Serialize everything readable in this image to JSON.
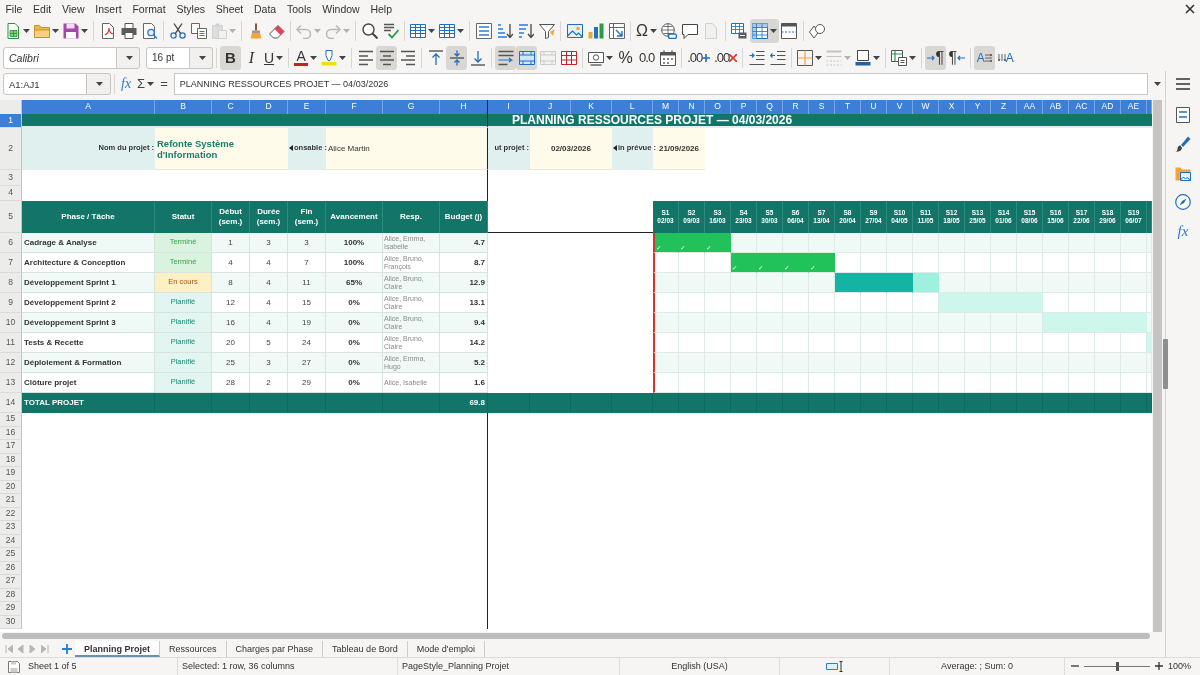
{
  "menu_bar": [
    "File",
    "Edit",
    "View",
    "Insert",
    "Format",
    "Styles",
    "Sheet",
    "Data",
    "Tools",
    "Window",
    "Help"
  ],
  "standard_toolbar": [
    [
      {
        "kind": "new",
        "dropdown": true,
        "pressed": false,
        "disabled": false
      },
      {
        "kind": "open",
        "dropdown": true,
        "pressed": false,
        "disabled": false
      },
      {
        "kind": "save",
        "dropdown": true,
        "pressed": false,
        "disabled": false
      }
    ],
    [
      {
        "kind": "export_pdf",
        "dropdown": false,
        "pressed": false,
        "disabled": false
      },
      {
        "kind": "print",
        "dropdown": false,
        "pressed": false,
        "disabled": false
      },
      {
        "kind": "print_preview",
        "dropdown": false,
        "pressed": false,
        "disabled": false
      }
    ],
    [
      {
        "kind": "cut",
        "dropdown": false,
        "pressed": false,
        "disabled": false
      },
      {
        "kind": "copy",
        "dropdown": false,
        "pressed": false,
        "disabled": false
      },
      {
        "kind": "paste",
        "dropdown": true,
        "pressed": false,
        "disabled": true
      }
    ],
    [
      {
        "kind": "clone_formatting",
        "dropdown": false,
        "pressed": false,
        "disabled": false
      },
      {
        "kind": "clear_formatting",
        "dropdown": false,
        "pressed": false,
        "disabled": false
      }
    ],
    [
      {
        "kind": "undo",
        "dropdown": true,
        "pressed": false,
        "disabled": true
      },
      {
        "kind": "redo",
        "dropdown": true,
        "pressed": false,
        "disabled": true
      }
    ],
    [
      {
        "kind": "find_replace",
        "dropdown": false,
        "pressed": false,
        "disabled": false
      },
      {
        "kind": "spelling",
        "dropdown": false,
        "pressed": false,
        "disabled": false
      }
    ],
    [
      {
        "kind": "row",
        "dropdown": true,
        "pressed": false,
        "disabled": false
      },
      {
        "kind": "column",
        "dropdown": true,
        "pressed": false,
        "disabled": false
      }
    ],
    [
      {
        "kind": "sort",
        "dropdown": false,
        "pressed": false,
        "disabled": false
      },
      {
        "kind": "sort_ascending",
        "dropdown": false,
        "pressed": false,
        "disabled": false
      },
      {
        "kind": "sort_descending",
        "dropdown": false,
        "pressed": false,
        "disabled": false
      },
      {
        "kind": "autofilter",
        "dropdown": false,
        "pressed": false,
        "disabled": false
      }
    ],
    [
      {
        "kind": "image",
        "dropdown": false,
        "pressed": false,
        "disabled": false
      },
      {
        "kind": "chart",
        "dropdown": false,
        "pressed": false,
        "disabled": false
      },
      {
        "kind": "pivot_table",
        "dropdown": false,
        "pressed": false,
        "disabled": false
      }
    ],
    [
      {
        "kind": "special_character",
        "glyph": "Ω",
        "dropdown": true,
        "pressed": false,
        "disabled": false
      },
      {
        "kind": "hyperlink",
        "dropdown": false,
        "pressed": false,
        "disabled": false
      },
      {
        "kind": "comment",
        "dropdown": false,
        "pressed": false,
        "disabled": false
      },
      {
        "kind": "header_footer",
        "dropdown": false,
        "pressed": false,
        "disabled": true
      }
    ],
    [
      {
        "kind": "print_area",
        "dropdown": false,
        "pressed": false,
        "disabled": false
      },
      {
        "kind": "freeze",
        "dropdown": true,
        "pressed": true,
        "disabled": false
      },
      {
        "kind": "split_window",
        "dropdown": false,
        "pressed": false,
        "disabled": false
      }
    ],
    [
      {
        "kind": "draw_functions",
        "dropdown": false,
        "pressed": false,
        "disabled": false
      }
    ]
  ],
  "formatting_toolbar": {
    "font_name": "Calibri",
    "font_size": "16 pt",
    "groups": [
      [
        {
          "kind": "bold",
          "glyph": "B",
          "dropdown": false,
          "pressed": true,
          "disabled": false
        },
        {
          "kind": "italic",
          "glyph": "I",
          "dropdown": false,
          "pressed": false,
          "disabled": false
        },
        {
          "kind": "underline",
          "glyph": "U",
          "dropdown": true,
          "pressed": false,
          "disabled": false
        }
      ],
      [
        {
          "kind": "font_color",
          "glyph": "A",
          "dropdown": true,
          "pressed": false,
          "disabled": false
        },
        {
          "kind": "highlight",
          "dropdown": true,
          "pressed": false,
          "disabled": false
        }
      ],
      [
        {
          "kind": "align_left",
          "dropdown": false,
          "pressed": false,
          "disabled": false
        },
        {
          "kind": "align_center",
          "dropdown": false,
          "pressed": true,
          "disabled": false
        },
        {
          "kind": "align_right",
          "dropdown": false,
          "pressed": false,
          "disabled": false
        }
      ],
      [
        {
          "kind": "align_top",
          "dropdown": false,
          "pressed": false,
          "disabled": false
        },
        {
          "kind": "align_middle",
          "dropdown": false,
          "pressed": true,
          "disabled": false
        },
        {
          "kind": "align_bottom",
          "dropdown": false,
          "pressed": false,
          "disabled": false
        }
      ],
      [
        {
          "kind": "wrap_text",
          "dropdown": false,
          "pressed": true,
          "disabled": false
        },
        {
          "kind": "merge_center",
          "dropdown": false,
          "pressed": true,
          "disabled": false
        },
        {
          "kind": "merge_cells",
          "dropdown": false,
          "pressed": false,
          "disabled": true
        },
        {
          "kind": "unmerge_cells",
          "dropdown": false,
          "pressed": false,
          "disabled": false
        }
      ],
      [
        {
          "kind": "number_format",
          "dropdown": true,
          "pressed": false,
          "disabled": false
        },
        {
          "kind": "percent",
          "glyph": "%",
          "dropdown": false,
          "pressed": false,
          "disabled": false
        },
        {
          "kind": "standard",
          "glyph": "0.0",
          "dropdown": false,
          "pressed": false,
          "disabled": false
        },
        {
          "kind": "date",
          "dropdown": false,
          "pressed": false,
          "disabled": false
        }
      ],
      [
        {
          "kind": "add_decimal",
          "glyph": ".00",
          "dropdown": false,
          "pressed": false,
          "disabled": false
        },
        {
          "kind": "delete_decimal",
          "glyph": ".00",
          "dropdown": false,
          "pressed": false,
          "disabled": false
        }
      ],
      [
        {
          "kind": "indent",
          "dropdown": false,
          "pressed": false,
          "disabled": false
        },
        {
          "kind": "outdent",
          "dropdown": false,
          "pressed": false,
          "disabled": false
        }
      ],
      [
        {
          "kind": "borders",
          "dropdown": true,
          "pressed": false,
          "disabled": false
        },
        {
          "kind": "border_style",
          "dropdown": true,
          "pressed": false,
          "disabled": true
        },
        {
          "kind": "border_color",
          "dropdown": true,
          "pressed": false,
          "disabled": false
        }
      ],
      [
        {
          "kind": "conditional",
          "dropdown": true,
          "pressed": false,
          "disabled": false
        }
      ],
      [
        {
          "kind": "left_to_right",
          "glyph": "¶",
          "dropdown": false,
          "pressed": true,
          "disabled": false
        },
        {
          "kind": "right_to_left",
          "glyph": "¶",
          "dropdown": false,
          "pressed": false,
          "disabled": false
        }
      ],
      [
        {
          "kind": "text_horizontal",
          "glyph": "A",
          "dropdown": false,
          "pressed": true,
          "disabled": false
        },
        {
          "kind": "text_vertical",
          "glyph": "A",
          "dropdown": false,
          "pressed": false,
          "disabled": false
        }
      ]
    ]
  },
  "formula_bar": {
    "name_box": "A1:AJ1",
    "wizard_glyph": "fx",
    "sum_glyph": "Σ",
    "equals_glyph": "=",
    "content": "PLANNING RESSOURCES PROJET — 04/03/2026"
  },
  "sidebar": {
    "tabs": [
      {
        "kind": "properties",
        "selected": false
      },
      {
        "kind": "styles",
        "selected": false
      },
      {
        "kind": "gallery",
        "selected": false
      },
      {
        "kind": "navigator",
        "selected": false
      },
      {
        "kind": "functions",
        "glyph": "fx",
        "selected": false
      }
    ]
  },
  "grid": {
    "columns": [
      {
        "label": "A",
        "selected": true
      },
      {
        "label": "B",
        "selected": true
      },
      {
        "label": "C",
        "selected": true
      },
      {
        "label": "D",
        "selected": true
      },
      {
        "label": "E",
        "selected": true
      },
      {
        "label": "F",
        "selected": true
      },
      {
        "label": "G",
        "selected": true
      },
      {
        "label": "H",
        "selected": true
      },
      {
        "label": "I",
        "selected": true
      },
      {
        "label": "J",
        "selected": true
      },
      {
        "label": "K",
        "selected": true
      },
      {
        "label": "L",
        "selected": true
      },
      {
        "label": "M",
        "selected": true
      },
      {
        "label": "N",
        "selected": true
      },
      {
        "label": "O",
        "selected": true
      },
      {
        "label": "P",
        "selected": true
      },
      {
        "label": "Q",
        "selected": true
      },
      {
        "label": "R",
        "selected": true
      },
      {
        "label": "S",
        "selected": true
      },
      {
        "label": "T",
        "selected": true
      },
      {
        "label": "U",
        "selected": true
      },
      {
        "label": "V",
        "selected": true
      },
      {
        "label": "W",
        "selected": true
      },
      {
        "label": "X",
        "selected": true
      },
      {
        "label": "Y",
        "selected": true
      },
      {
        "label": "Z",
        "selected": true
      },
      {
        "label": "AA",
        "selected": true
      },
      {
        "label": "AB",
        "selected": true
      },
      {
        "label": "AC",
        "selected": true
      },
      {
        "label": "AD",
        "selected": true
      },
      {
        "label": "AE",
        "selected": true
      },
      {
        "selected": true
      }
    ],
    "rows": [
      {
        "label": "1",
        "selected": true
      },
      {
        "label": "2",
        "selected": false
      },
      {
        "label": "3",
        "selected": false
      },
      {
        "label": "4",
        "selected": false
      },
      {
        "label": "5",
        "selected": false
      },
      {
        "label": "6",
        "selected": false
      },
      {
        "label": "7",
        "selected": false
      },
      {
        "label": "8",
        "selected": false
      },
      {
        "label": "9",
        "selected": false
      },
      {
        "label": "10",
        "selected": false
      },
      {
        "label": "11",
        "selected": false
      },
      {
        "label": "12",
        "selected": false
      },
      {
        "label": "13",
        "selected": false
      },
      {
        "label": "14",
        "selected": false
      },
      {
        "label": "15",
        "selected": false
      },
      {
        "label": "16",
        "selected": false
      },
      {
        "label": "17",
        "selected": false
      },
      {
        "label": "18",
        "selected": false
      },
      {
        "label": "19",
        "selected": false
      },
      {
        "label": "20",
        "selected": false
      },
      {
        "label": "21",
        "selected": false
      },
      {
        "label": "22",
        "selected": false
      },
      {
        "label": "23",
        "selected": false
      },
      {
        "label": "24",
        "selected": false
      },
      {
        "label": "25",
        "selected": false
      },
      {
        "label": "26",
        "selected": false
      },
      {
        "label": "27",
        "selected": false
      },
      {
        "label": "28",
        "selected": false
      },
      {
        "label": "29",
        "selected": false
      },
      {
        "label": "30",
        "selected": false
      }
    ]
  },
  "sheet": {
    "title": "PLANNING RESSOURCES PROJET — 04/03/2026",
    "info": {
      "project_label": {
        "text": "Nom du projet :",
        "clipped": false
      },
      "project_name": "Refonte Système d'Information",
      "manager_label": {
        "text": "onsable :",
        "clipped": true
      },
      "manager": "Alice Martin",
      "start_label": {
        "text": "ut projet :",
        "clipped": false
      },
      "start_date": "02/03/2026",
      "end_label": {
        "text": "in prévue :",
        "clipped": true
      },
      "end_date": "21/09/2026"
    },
    "headers": [
      "Phase / Tâche",
      "Statut",
      "Début (sem.)",
      "Durée (sem.)",
      "Fin (sem.)",
      "Avancement",
      "Resp.",
      "Budget (j)"
    ],
    "weeks": [
      {
        "label": "S1",
        "date": "02/03",
        "current": true
      },
      {
        "label": "S2",
        "date": "09/03",
        "current": false
      },
      {
        "label": "S3",
        "date": "16/03",
        "current": false
      },
      {
        "label": "S4",
        "date": "23/03",
        "current": false
      },
      {
        "label": "S5",
        "date": "30/03",
        "current": false
      },
      {
        "label": "S6",
        "date": "06/04",
        "current": false
      },
      {
        "label": "S7",
        "date": "13/04",
        "current": false
      },
      {
        "label": "S8",
        "date": "20/04",
        "current": false
      },
      {
        "label": "S9",
        "date": "27/04",
        "current": false
      },
      {
        "label": "S10",
        "date": "04/05",
        "current": false
      },
      {
        "label": "S11",
        "date": "11/05",
        "current": false
      },
      {
        "label": "S12",
        "date": "18/05",
        "current": false
      },
      {
        "label": "S13",
        "date": "25/05",
        "current": false
      },
      {
        "label": "S14",
        "date": "01/06",
        "current": false
      },
      {
        "label": "S15",
        "date": "08/06",
        "current": false
      },
      {
        "label": "S16",
        "date": "15/06",
        "current": false
      },
      {
        "label": "S17",
        "date": "22/06",
        "current": false
      },
      {
        "label": "S18",
        "date": "29/06",
        "current": false
      },
      {
        "label": "S19",
        "date": "06/07",
        "current": false
      }
    ],
    "tasks": [
      {
        "name": "Cadrage & Analyse",
        "status": {
          "text": "Terminé",
          "kind": "done"
        },
        "start": "1",
        "duration": "3",
        "end": "3",
        "progress": "100%",
        "resp": "Alice, Emma, Isabelle",
        "budget": "4.7",
        "gantt": [
          {
            "kind": "done",
            "text": "✓"
          },
          {
            "kind": "done",
            "text": "✓"
          },
          {
            "kind": "done",
            "text": "✓"
          },
          {
            "kind": "none"
          },
          {
            "kind": "none"
          },
          {
            "kind": "none"
          },
          {
            "kind": "none"
          },
          {
            "kind": "none"
          },
          {
            "kind": "none"
          },
          {
            "kind": "none"
          },
          {
            "kind": "none"
          },
          {
            "kind": "none"
          },
          {
            "kind": "none"
          },
          {
            "kind": "none"
          },
          {
            "kind": "none"
          },
          {
            "kind": "none"
          },
          {
            "kind": "none"
          },
          {
            "kind": "none"
          },
          {
            "kind": "none"
          },
          {
            "kind": "none"
          }
        ]
      },
      {
        "name": "Architecture & Conception",
        "status": {
          "text": "Terminé",
          "kind": "done"
        },
        "start": "4",
        "duration": "4",
        "end": "7",
        "progress": "100%",
        "resp": "Alice, Bruno, François",
        "budget": "8.7",
        "gantt": [
          {
            "kind": "none"
          },
          {
            "kind": "none"
          },
          {
            "kind": "none"
          },
          {
            "kind": "done",
            "text": "✓"
          },
          {
            "kind": "done",
            "text": "✓"
          },
          {
            "kind": "done",
            "text": "✓"
          },
          {
            "kind": "done",
            "text": "✓"
          },
          {
            "kind": "none"
          },
          {
            "kind": "none"
          },
          {
            "kind": "none"
          },
          {
            "kind": "none"
          },
          {
            "kind": "none"
          },
          {
            "kind": "none"
          },
          {
            "kind": "none"
          },
          {
            "kind": "none"
          },
          {
            "kind": "none"
          },
          {
            "kind": "none"
          },
          {
            "kind": "none"
          },
          {
            "kind": "none"
          },
          {
            "kind": "none"
          }
        ]
      },
      {
        "name": "Développement Sprint 1",
        "status": {
          "text": "En cours",
          "kind": "in_progress"
        },
        "start": "8",
        "duration": "4",
        "end": "11",
        "progress": "65%",
        "resp": "Alice, Bruno, Claire",
        "budget": "12.9",
        "gantt": [
          {
            "kind": "none"
          },
          {
            "kind": "none"
          },
          {
            "kind": "none"
          },
          {
            "kind": "none"
          },
          {
            "kind": "none"
          },
          {
            "kind": "none"
          },
          {
            "kind": "none"
          },
          {
            "kind": "active"
          },
          {
            "kind": "active"
          },
          {
            "kind": "active"
          },
          {
            "kind": "remaining"
          },
          {
            "kind": "none"
          },
          {
            "kind": "none"
          },
          {
            "kind": "none"
          },
          {
            "kind": "none"
          },
          {
            "kind": "none"
          },
          {
            "kind": "none"
          },
          {
            "kind": "none"
          },
          {
            "kind": "none"
          },
          {
            "kind": "none"
          }
        ]
      },
      {
        "name": "Développement Sprint 2",
        "status": {
          "text": "Planifié",
          "kind": "planned"
        },
        "start": "12",
        "duration": "4",
        "end": "15",
        "progress": "0%",
        "resp": "Alice, Bruno, Claire",
        "budget": "13.1",
        "gantt": [
          {
            "kind": "none"
          },
          {
            "kind": "none"
          },
          {
            "kind": "none"
          },
          {
            "kind": "none"
          },
          {
            "kind": "none"
          },
          {
            "kind": "none"
          },
          {
            "kind": "none"
          },
          {
            "kind": "none"
          },
          {
            "kind": "none"
          },
          {
            "kind": "none"
          },
          {
            "kind": "none"
          },
          {
            "kind": "planned"
          },
          {
            "kind": "planned"
          },
          {
            "kind": "planned"
          },
          {
            "kind": "planned"
          },
          {
            "kind": "none"
          },
          {
            "kind": "none"
          },
          {
            "kind": "none"
          },
          {
            "kind": "none"
          },
          {
            "kind": "none"
          }
        ]
      },
      {
        "name": "Développement Sprint 3",
        "status": {
          "text": "Planifié",
          "kind": "planned"
        },
        "start": "16",
        "duration": "4",
        "end": "19",
        "progress": "0%",
        "resp": "Alice, Bruno, Claire",
        "budget": "9.4",
        "gantt": [
          {
            "kind": "none"
          },
          {
            "kind": "none"
          },
          {
            "kind": "none"
          },
          {
            "kind": "none"
          },
          {
            "kind": "none"
          },
          {
            "kind": "none"
          },
          {
            "kind": "none"
          },
          {
            "kind": "none"
          },
          {
            "kind": "none"
          },
          {
            "kind": "none"
          },
          {
            "kind": "none"
          },
          {
            "kind": "none"
          },
          {
            "kind": "none"
          },
          {
            "kind": "none"
          },
          {
            "kind": "none"
          },
          {
            "kind": "planned"
          },
          {
            "kind": "planned"
          },
          {
            "kind": "planned"
          },
          {
            "kind": "planned"
          },
          {
            "kind": "none"
          }
        ]
      },
      {
        "name": "Tests & Recette",
        "status": {
          "text": "Planifié",
          "kind": "planned"
        },
        "start": "20",
        "duration": "5",
        "end": "24",
        "progress": "0%",
        "resp": "Alice, Bruno, Claire",
        "budget": "14.2",
        "gantt": [
          {
            "kind": "none"
          },
          {
            "kind": "none"
          },
          {
            "kind": "none"
          },
          {
            "kind": "none"
          },
          {
            "kind": "none"
          },
          {
            "kind": "none"
          },
          {
            "kind": "none"
          },
          {
            "kind": "none"
          },
          {
            "kind": "none"
          },
          {
            "kind": "none"
          },
          {
            "kind": "none"
          },
          {
            "kind": "none"
          },
          {
            "kind": "none"
          },
          {
            "kind": "none"
          },
          {
            "kind": "none"
          },
          {
            "kind": "none"
          },
          {
            "kind": "none"
          },
          {
            "kind": "none"
          },
          {
            "kind": "none"
          },
          {
            "kind": "planned"
          }
        ]
      },
      {
        "name": "Déploiement & Formation",
        "status": {
          "text": "Planifié",
          "kind": "planned"
        },
        "start": "25",
        "duration": "3",
        "end": "27",
        "progress": "0%",
        "resp": "Alice, Emma, Hugo",
        "budget": "5.2",
        "gantt": [
          {
            "kind": "none"
          },
          {
            "kind": "none"
          },
          {
            "kind": "none"
          },
          {
            "kind": "none"
          },
          {
            "kind": "none"
          },
          {
            "kind": "none"
          },
          {
            "kind": "none"
          },
          {
            "kind": "none"
          },
          {
            "kind": "none"
          },
          {
            "kind": "none"
          },
          {
            "kind": "none"
          },
          {
            "kind": "none"
          },
          {
            "kind": "none"
          },
          {
            "kind": "none"
          },
          {
            "kind": "none"
          },
          {
            "kind": "none"
          },
          {
            "kind": "none"
          },
          {
            "kind": "none"
          },
          {
            "kind": "none"
          },
          {
            "kind": "none"
          }
        ]
      },
      {
        "name": "Clôture projet",
        "status": {
          "text": "Planifié",
          "kind": "planned"
        },
        "start": "28",
        "duration": "2",
        "end": "29",
        "progress": "0%",
        "resp": "Alice, Isabelle",
        "budget": "1.6",
        "gantt": [
          {
            "kind": "none"
          },
          {
            "kind": "none"
          },
          {
            "kind": "none"
          },
          {
            "kind": "none"
          },
          {
            "kind": "none"
          },
          {
            "kind": "none"
          },
          {
            "kind": "none"
          },
          {
            "kind": "none"
          },
          {
            "kind": "none"
          },
          {
            "kind": "none"
          },
          {
            "kind": "none"
          },
          {
            "kind": "none"
          },
          {
            "kind": "none"
          },
          {
            "kind": "none"
          },
          {
            "kind": "none"
          },
          {
            "kind": "none"
          },
          {
            "kind": "none"
          },
          {
            "kind": "none"
          },
          {
            "kind": "none"
          },
          {
            "kind": "none"
          }
        ]
      }
    ],
    "total": {
      "label": "TOTAL PROJET",
      "budget": "69.8"
    }
  },
  "sheet_navigation": {
    "disabled": true
  },
  "sheet_tabs": [
    {
      "label": "Planning Projet",
      "selected": true
    },
    {
      "label": "Ressources",
      "selected": false
    },
    {
      "label": "Charges par Phase",
      "selected": false
    },
    {
      "label": "Tableau de Bord",
      "selected": false
    },
    {
      "label": "Mode d'emploi",
      "selected": false
    }
  ],
  "status_bar": {
    "sheet": "Sheet 1 of 5",
    "selection": "Selected: 1 row, 36 columns",
    "page_style": "PageStyle_Planning Projet",
    "language": "English (USA)",
    "summary": "Average: ; Sum: 0",
    "zoom": "100%",
    "zoom_slider": {
      "level": 0.5
    }
  }
}
